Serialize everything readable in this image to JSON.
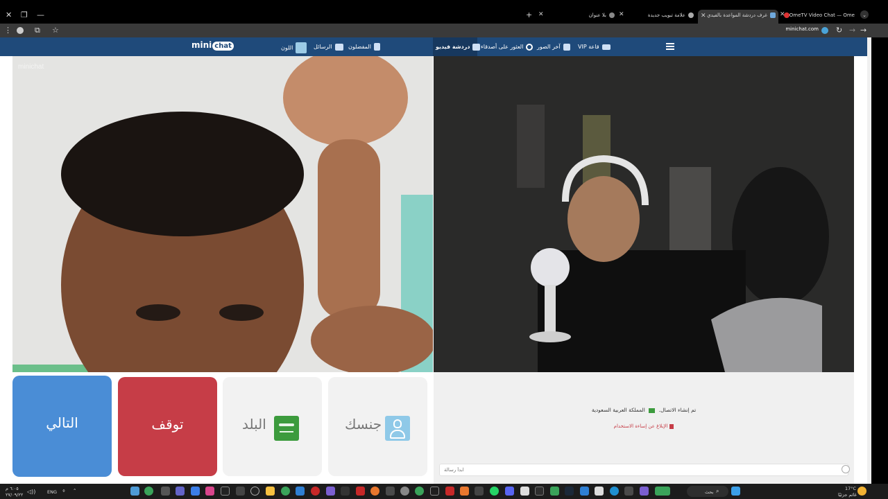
{
  "browser": {
    "tabs": [
      {
        "title": "OmeTV Video Chat — Ome",
        "active": false
      },
      {
        "title": "غرف دردشة المواعدة بالفيدي",
        "active": true
      },
      {
        "title": "علامة تبويب جديدة",
        "active": false
      },
      {
        "title": "بلا عنوان",
        "active": false
      }
    ],
    "new_tab": "+",
    "url": "minichat.com"
  },
  "site": {
    "logo_prefix": "mini",
    "logo_suffix": "chat",
    "nav": {
      "vip": "قاعة VIP",
      "latest_photos": "آخر الصور",
      "find_by_name": "العثور على أصدقاء",
      "video_chat": "دردشة فيديو",
      "favorites": "المفضلون",
      "messages": "الرسائل",
      "color": "اللون"
    },
    "watermark": "minichat"
  },
  "controls": {
    "next": "التالي",
    "stop": "توقف",
    "country": "البلد",
    "gender": "جنسك"
  },
  "chat": {
    "connected": "تم إنشاء الاتصال.",
    "country": "المملكة العربية السعودية",
    "report": "الإبلاغ عن إساءة الاستخدام",
    "input_placeholder": "ابدأ رسالة"
  },
  "taskbar": {
    "search": "بحث",
    "lang": "ENG",
    "weather_temp": "17°C",
    "weather_desc": "غائم جزئيًا",
    "time": "٦:٠٥ م",
    "date": "٢٧/٠٩/٢٢"
  },
  "colors": {
    "nav_bg": "#1f4a7a",
    "next_btn": "#4a8dd6",
    "stop_btn": "#c63d47",
    "flag_green": "#3c9b3d"
  }
}
